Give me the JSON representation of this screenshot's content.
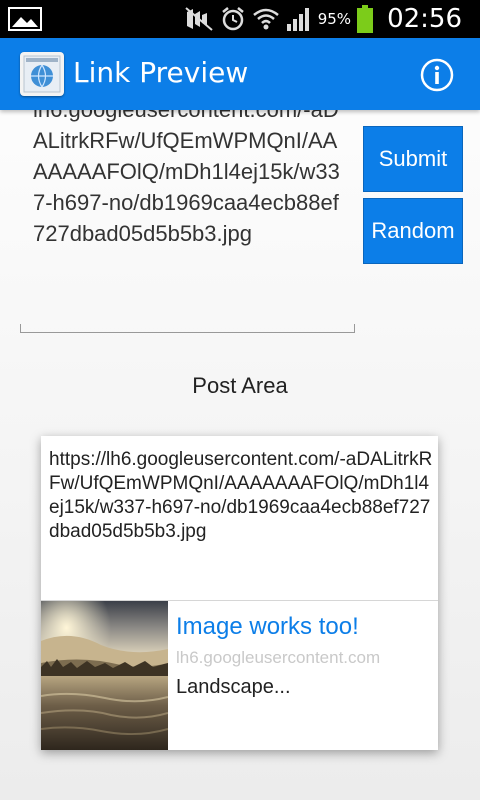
{
  "status_bar": {
    "battery_percent": "95%",
    "time": "02:56",
    "icons": [
      "gallery-icon",
      "mute-icon",
      "alarm-icon",
      "wifi-icon",
      "signal-icon",
      "battery-icon"
    ]
  },
  "action_bar": {
    "title": "Link Preview",
    "info_icon": "info-icon"
  },
  "form": {
    "url_value": "lh6.googleusercontent.com/-aDALitrkRFw/UfQEmWPMQnI/AAAAAAAFOlQ/mDh1l4ej15k/w337-h697-no/db1969caa4ecb88ef727dbad05d5b5b3.jpg",
    "submit_label": "Submit",
    "random_label": "Random"
  },
  "post_area": {
    "label": "Post Area",
    "card": {
      "url": "https://lh6.googleusercontent.com/-aDALitrkRFw/UfQEmWPMQnI/AAAAAAAFOlQ/mDh1l4ej15k/w337-h697-no/db1969caa4ecb88ef727dbad05d5b5b3.jpg",
      "title": "Image works too!",
      "domain": "lh6.googleusercontent.com",
      "description": "Landscape..."
    }
  },
  "colors": {
    "accent": "#0c7ee8",
    "status_bar": "#000000",
    "battery": "#7ccc1a"
  }
}
